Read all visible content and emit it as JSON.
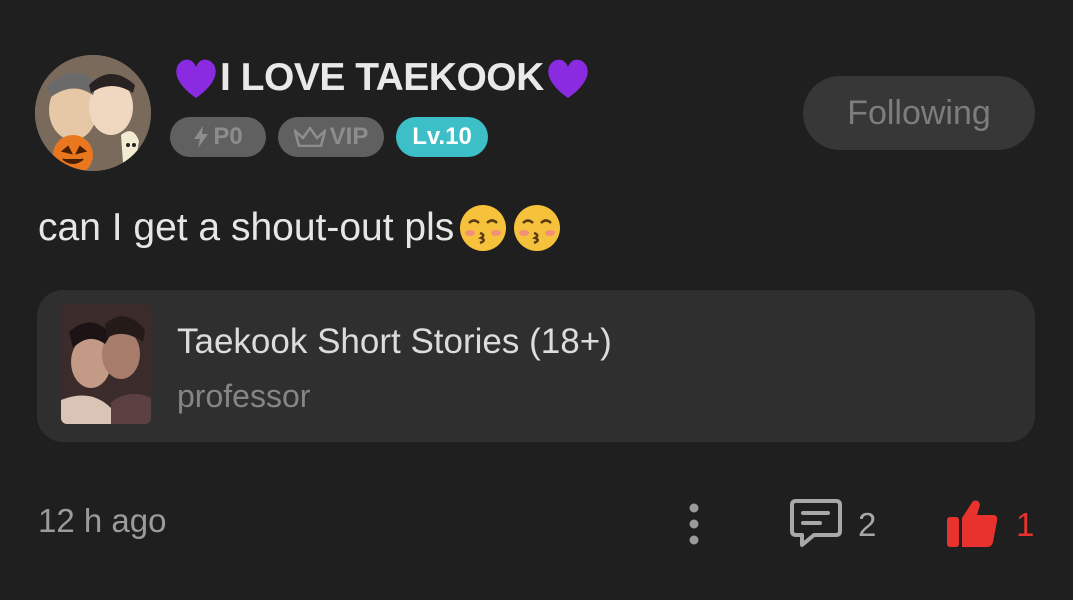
{
  "post": {
    "author": {
      "name": "I LOVE TAEKOOK",
      "name_decoration": "purple-heart-emoji",
      "badges": [
        {
          "label": "P0",
          "icon": "lightning-icon"
        },
        {
          "label": "VIP",
          "icon": "crown-icon"
        },
        {
          "label": "Lv.10"
        }
      ]
    },
    "follow_button": "Following",
    "text": "can I get a shout-out pls",
    "text_emoji": "kissing-face-emoji",
    "linked_story": {
      "title": "Taekook Short Stories (18+)",
      "subtitle": "professor"
    },
    "time": "12 h ago",
    "comments": "2",
    "likes": "1"
  },
  "colors": {
    "background": "#1f1f1f",
    "card": "#2f2f2f",
    "level_badge": "#3cbfc6",
    "like_red": "#e8322d",
    "heart_purple": "#8a2be2"
  }
}
